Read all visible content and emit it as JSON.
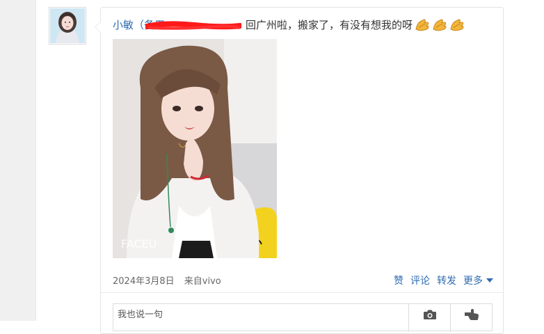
{
  "post": {
    "author": "小敏（备用",
    "text": "回广州啦，搬家了，有没有想我的呀",
    "emoji": [
      "praying-hands",
      "praying-hands",
      "praying-hands"
    ],
    "date": "2024年3月8日",
    "source": "来自vivo",
    "photo_watermark": "FACEU"
  },
  "actions": {
    "like": "赞",
    "comment": "评论",
    "share": "转发",
    "more": "更多"
  },
  "comment_box": {
    "placeholder": "我也说一句",
    "camera_icon": "camera-icon",
    "send_icon": "hand-pointer-icon"
  },
  "colors": {
    "link": "#2e6bb0",
    "redaction": "#ff1a1a",
    "gutter": "#f0f0f0",
    "border": "#e3e3e3"
  }
}
